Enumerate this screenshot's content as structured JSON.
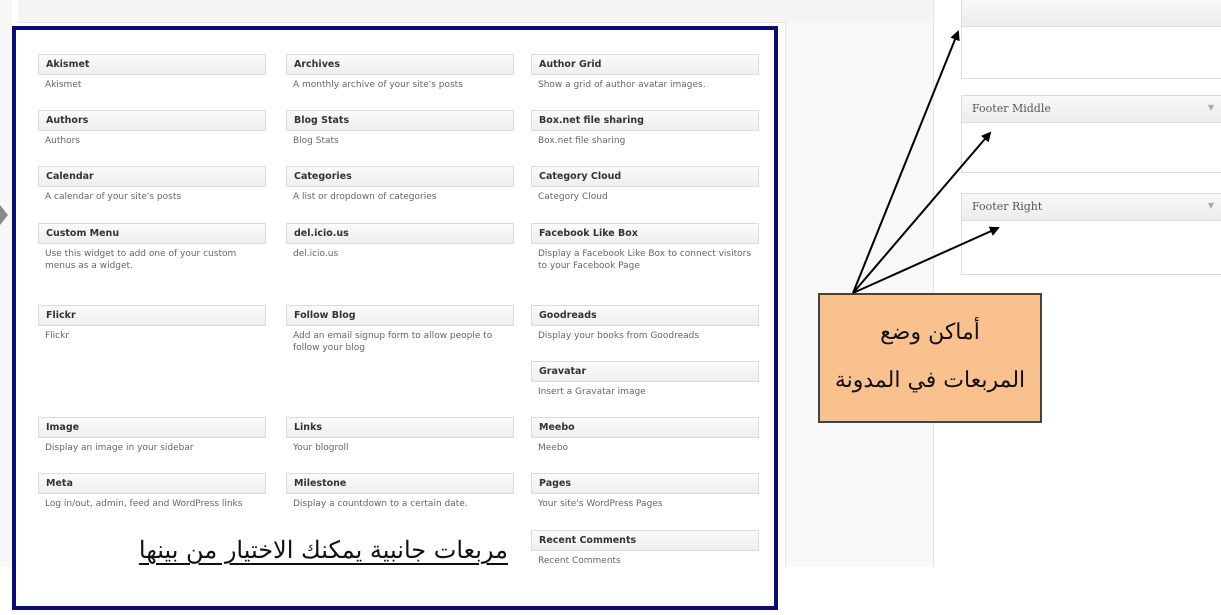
{
  "footer_boxes": {
    "middle": "Footer Middle",
    "right": "Footer Right",
    "chevron": "▼"
  },
  "widgets": [
    {
      "title": "Akismet",
      "desc": "Akismet"
    },
    {
      "title": "Archives",
      "desc": "A monthly archive of your site's posts"
    },
    {
      "title": "Author Grid",
      "desc": "Show a grid of author avatar images."
    },
    {
      "title": "Authors",
      "desc": "Authors"
    },
    {
      "title": "Blog Stats",
      "desc": "Blog Stats"
    },
    {
      "title": "Box.net file sharing",
      "desc": "Box.net file sharing"
    },
    {
      "title": "Calendar",
      "desc": "A calendar of your site's posts"
    },
    {
      "title": "Categories",
      "desc": "A list or dropdown of categories"
    },
    {
      "title": "Category Cloud",
      "desc": "Category Cloud"
    },
    {
      "title": "Custom Menu",
      "desc": "Use this widget to add one of your custom menus as a widget."
    },
    {
      "title": "del.icio.us",
      "desc": "del.icio.us"
    },
    {
      "title": "Facebook Like Box",
      "desc": "Display a Facebook Like Box to connect visitors to your Facebook Page"
    },
    {
      "title": "Flickr",
      "desc": "Flickr"
    },
    {
      "title": "Follow Blog",
      "desc": "Add an email signup form to allow people to follow your blog"
    },
    {
      "title": "Goodreads",
      "desc": "Display your books from Goodreads"
    },
    {
      "title": "Gravatar",
      "desc": "Insert a Gravatar image"
    },
    {
      "title": "Image",
      "desc": "Display an image in your sidebar"
    },
    {
      "title": "Links",
      "desc": "Your blogroll"
    },
    {
      "title": "Meebo",
      "desc": "Meebo"
    },
    {
      "title": "Meta",
      "desc": "Log in/out, admin, feed and WordPress links"
    },
    {
      "title": "Milestone",
      "desc": "Display a countdown to a certain date."
    },
    {
      "title": "Pages",
      "desc": "Your site's WordPress Pages"
    },
    {
      "title": "Recent Comments",
      "desc": "Recent Comments"
    }
  ],
  "annotations": {
    "caption": "مربعات جانبية يمكنك الاختيار من بينها",
    "note_line1": "أماكن وضع",
    "note_line2": "المربعات في المدونة"
  }
}
